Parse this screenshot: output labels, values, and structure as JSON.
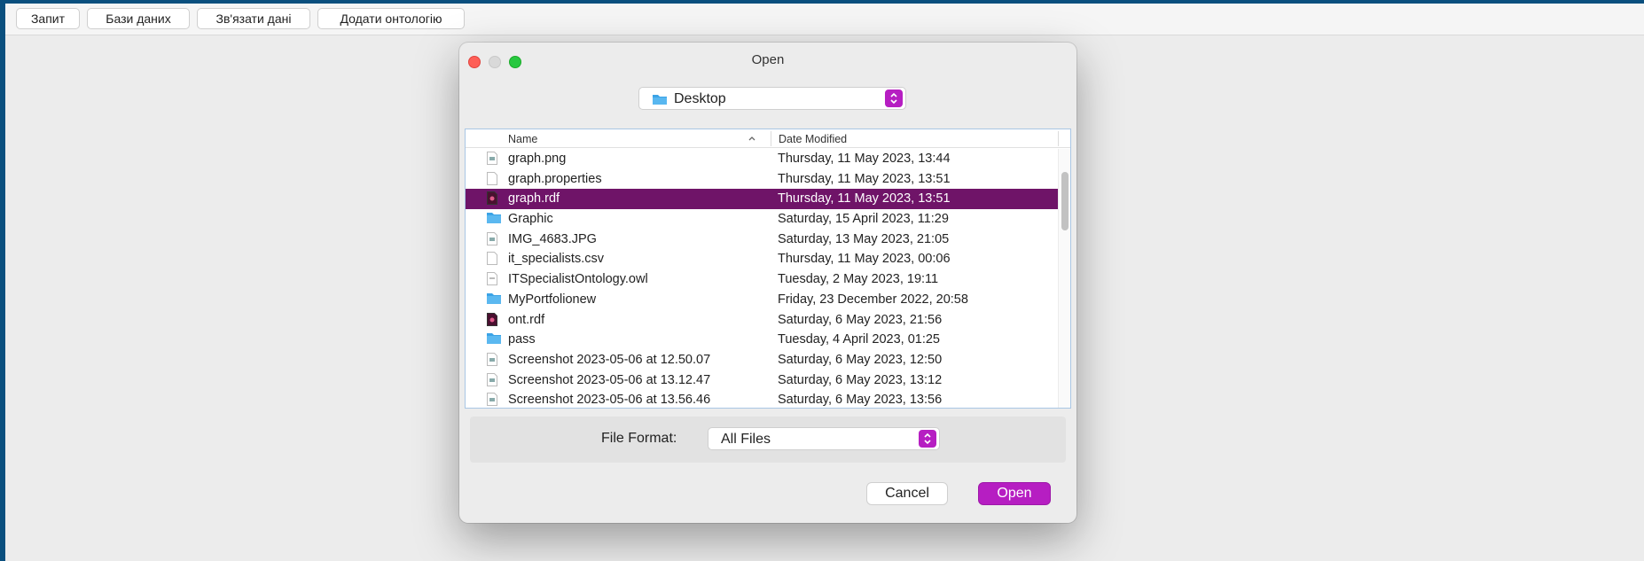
{
  "menubar": {
    "items": [
      {
        "label": "Запит"
      },
      {
        "label": "Бази даних"
      },
      {
        "label": "Зв'язати дані"
      },
      {
        "label": "Додати онтологію"
      }
    ]
  },
  "dialog": {
    "title": "Open",
    "location": {
      "label": "Desktop",
      "icon": "folder-icon"
    },
    "columns": {
      "name": "Name",
      "date": "Date Modified",
      "sort": "ascending"
    },
    "selected_index": 2,
    "files": [
      {
        "name": "graph.png",
        "date": "Thursday, 11 May 2023, 13:44",
        "icon": "image-file-icon"
      },
      {
        "name": "graph.properties",
        "date": "Thursday, 11 May 2023, 13:51",
        "icon": "document-icon"
      },
      {
        "name": "graph.rdf",
        "date": "Thursday, 11 May 2023, 13:51",
        "icon": "rdf-file-icon"
      },
      {
        "name": "Graphic",
        "date": "Saturday, 15 April 2023, 11:29",
        "icon": "folder-icon"
      },
      {
        "name": "IMG_4683.JPG",
        "date": "Saturday, 13 May 2023, 21:05",
        "icon": "image-file-icon"
      },
      {
        "name": "it_specialists.csv",
        "date": "Thursday, 11 May 2023, 00:06",
        "icon": "document-icon"
      },
      {
        "name": "ITSpecialistOntology.owl",
        "date": "Tuesday, 2 May 2023, 19:11",
        "icon": "owl-file-icon"
      },
      {
        "name": "MyPortfolionew",
        "date": "Friday, 23 December 2022, 20:58",
        "icon": "folder-icon"
      },
      {
        "name": "ont.rdf",
        "date": "Saturday, 6 May 2023, 21:56",
        "icon": "rdf-file-icon"
      },
      {
        "name": "pass",
        "date": "Tuesday, 4 April 2023, 01:25",
        "icon": "folder-icon"
      },
      {
        "name": "Screenshot 2023-05-06 at 12.50.07",
        "date": "Saturday, 6 May 2023, 12:50",
        "icon": "image-file-icon"
      },
      {
        "name": "Screenshot 2023-05-06 at 13.12.47",
        "date": "Saturday, 6 May 2023, 13:12",
        "icon": "image-file-icon"
      },
      {
        "name": "Screenshot 2023-05-06 at 13.56.46",
        "date": "Saturday, 6 May 2023, 13:56",
        "icon": "image-file-icon"
      }
    ],
    "file_format": {
      "label": "File Format:",
      "value": "All Files"
    },
    "buttons": {
      "cancel": "Cancel",
      "open": "Open"
    }
  },
  "colors": {
    "accent": "#b61ec2",
    "selection": "#6f1468",
    "folder": "#3ba3e6",
    "desktop_frame": "#0a4f7e"
  }
}
